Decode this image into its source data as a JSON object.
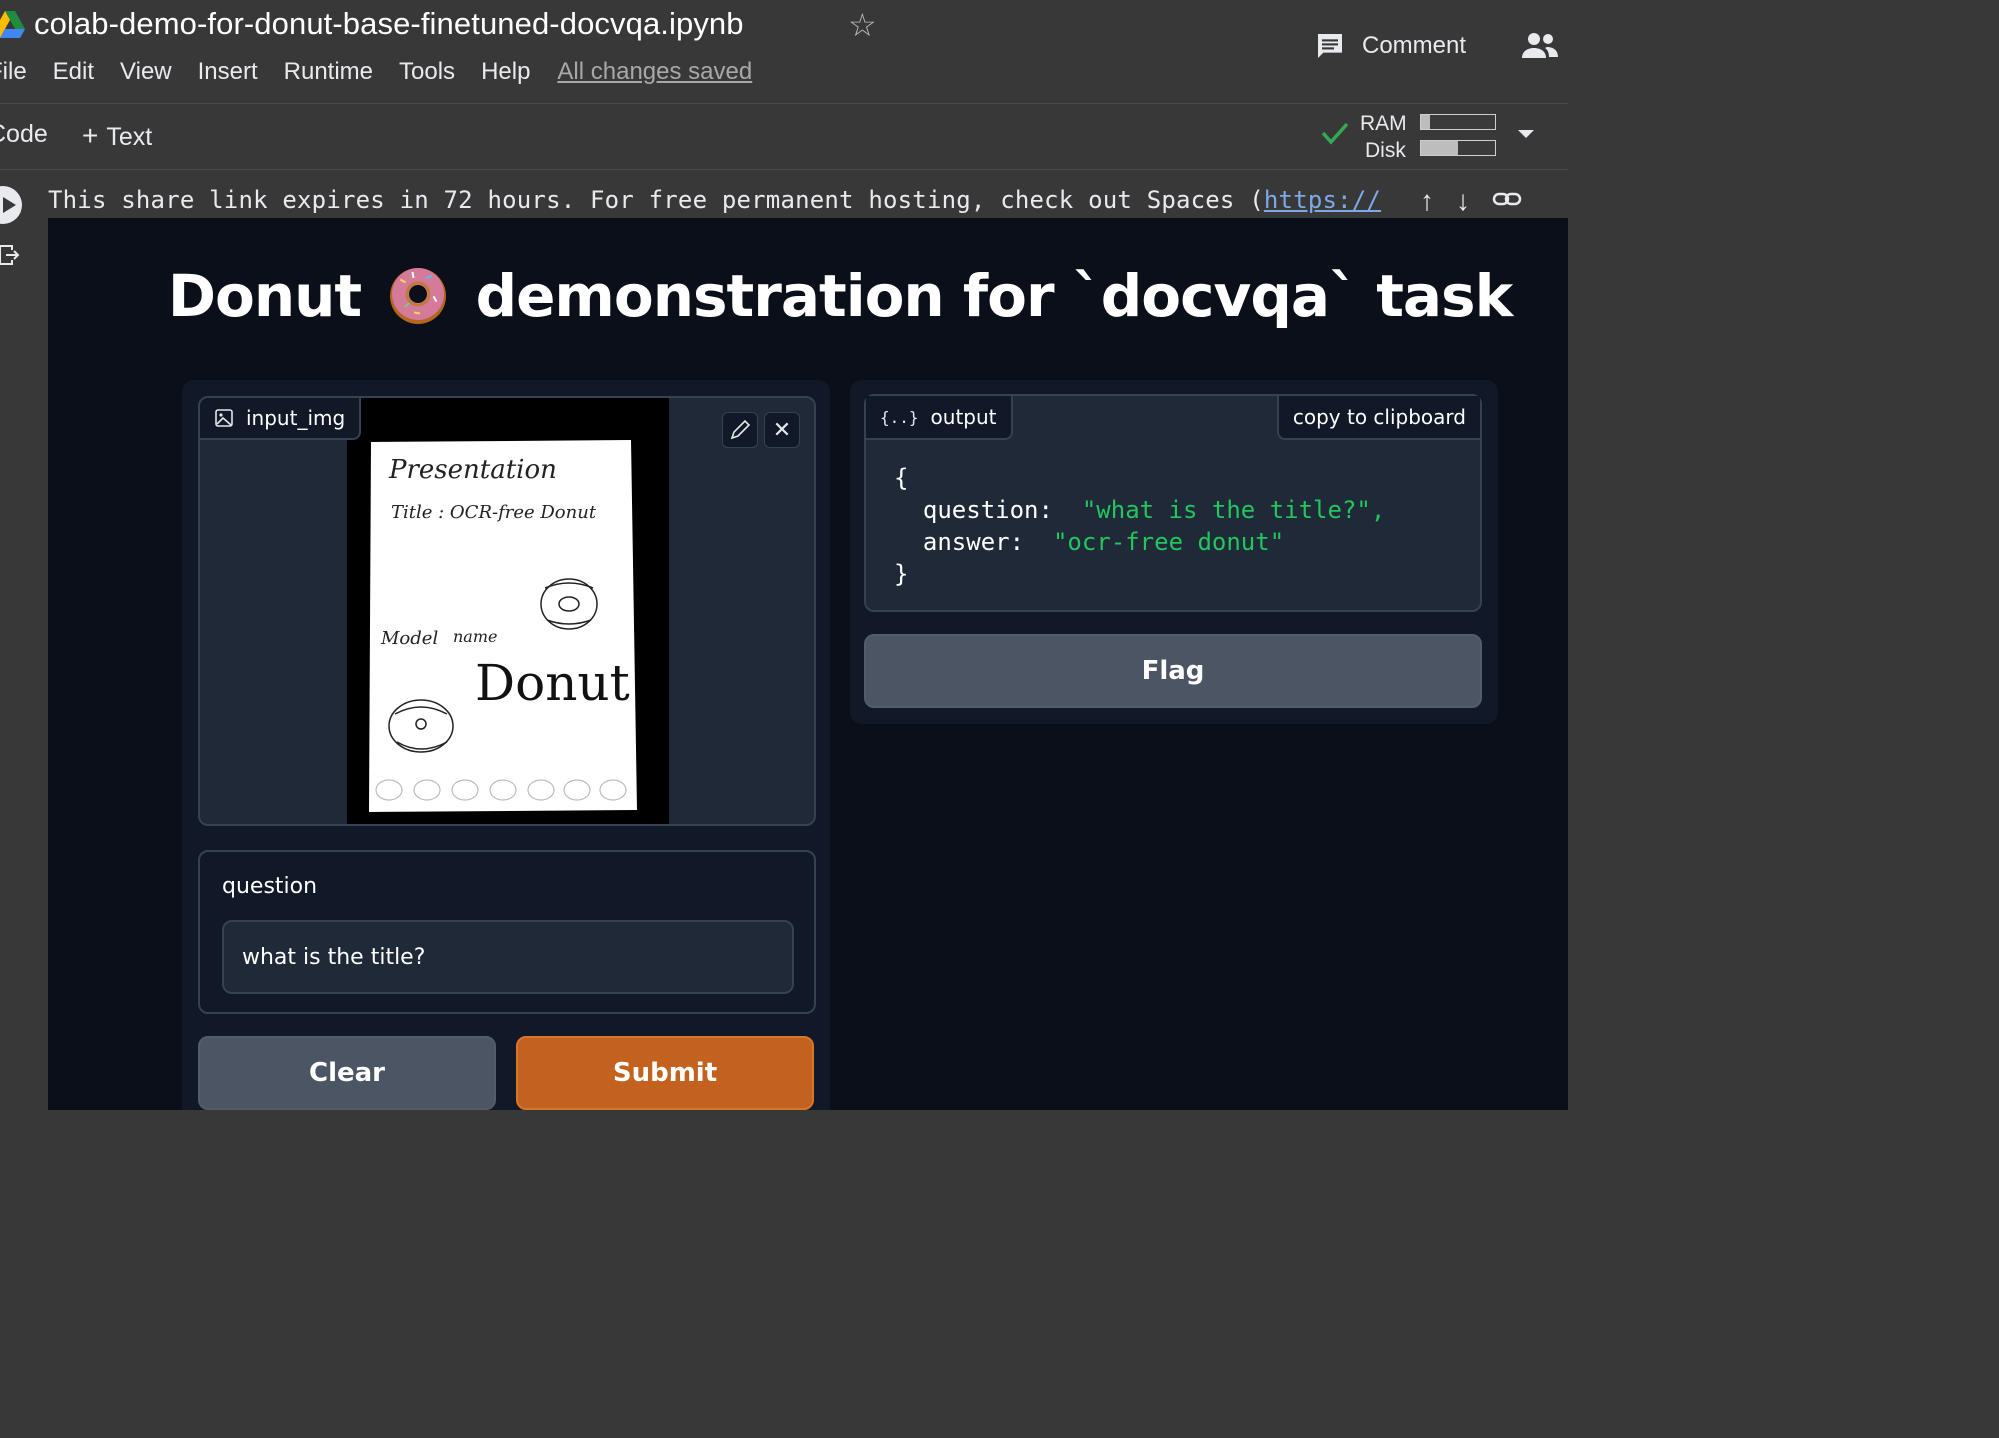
{
  "colab": {
    "title": "colab-demo-for-donut-base-finetuned-docvqa.ipynb",
    "menu": [
      "File",
      "Edit",
      "View",
      "Insert",
      "Runtime",
      "Tools",
      "Help"
    ],
    "save_status": "All changes saved",
    "comment_label": "Comment",
    "toolbar": {
      "code_label": "Code",
      "text_label": "Text"
    },
    "resources": {
      "ram_label": "RAM",
      "disk_label": "Disk",
      "ram_fraction": 0.12,
      "disk_fraction": 0.5
    }
  },
  "cell_output": {
    "share_text": "This share link expires in 72 hours. For free permanent hosting, check out Spaces (",
    "share_link": "https://"
  },
  "app": {
    "title_part1": "Donut",
    "title_part2": "demonstration for `docvqa` task",
    "input_image": {
      "label": "input_img",
      "sketch_lines": [
        "Presentation",
        "Title : OCR-free Donut",
        "Model",
        "name",
        "Donut"
      ]
    },
    "question": {
      "label": "question",
      "value": "what is the title?"
    },
    "buttons": {
      "clear": "Clear",
      "submit": "Submit",
      "flag": "Flag"
    },
    "output": {
      "label": "output",
      "copy_label": "copy to clipboard",
      "json": {
        "open": "{",
        "question_key": "question:",
        "question_value": "\"what is the title?\",",
        "answer_key": "answer:",
        "answer_value": "\"ocr-free donut\"",
        "close": "}"
      }
    }
  },
  "colors": {
    "accent": "#c2621e",
    "bg_dark": "#0b0f19",
    "json_string": "#22c55e",
    "link": "#7fa9e6"
  }
}
